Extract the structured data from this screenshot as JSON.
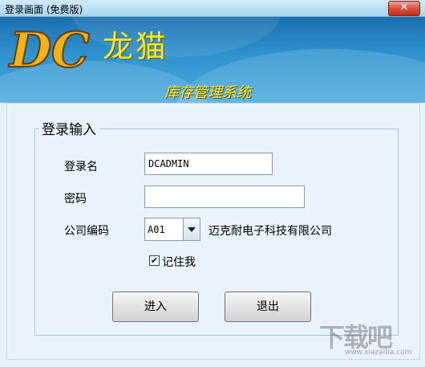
{
  "window": {
    "title": "登录画面 (免费版)",
    "close_label": "✕"
  },
  "banner": {
    "logo_text": "DC",
    "app_name": "龙猫",
    "subtitle": "库存管理系统"
  },
  "form": {
    "group_title": "登录输入",
    "username_label": "登录名",
    "username_value": "DCADMIN",
    "password_label": "密码",
    "password_value": "",
    "company_label": "公司编码",
    "company_code": "A01",
    "company_name": "迈克耐电子科技有限公司",
    "remember_label": "记住我",
    "remember_checked": true
  },
  "buttons": {
    "login": "进入",
    "exit": "退出"
  },
  "watermark": {
    "text": "下载吧",
    "url": "www.xiazaiba.com"
  }
}
